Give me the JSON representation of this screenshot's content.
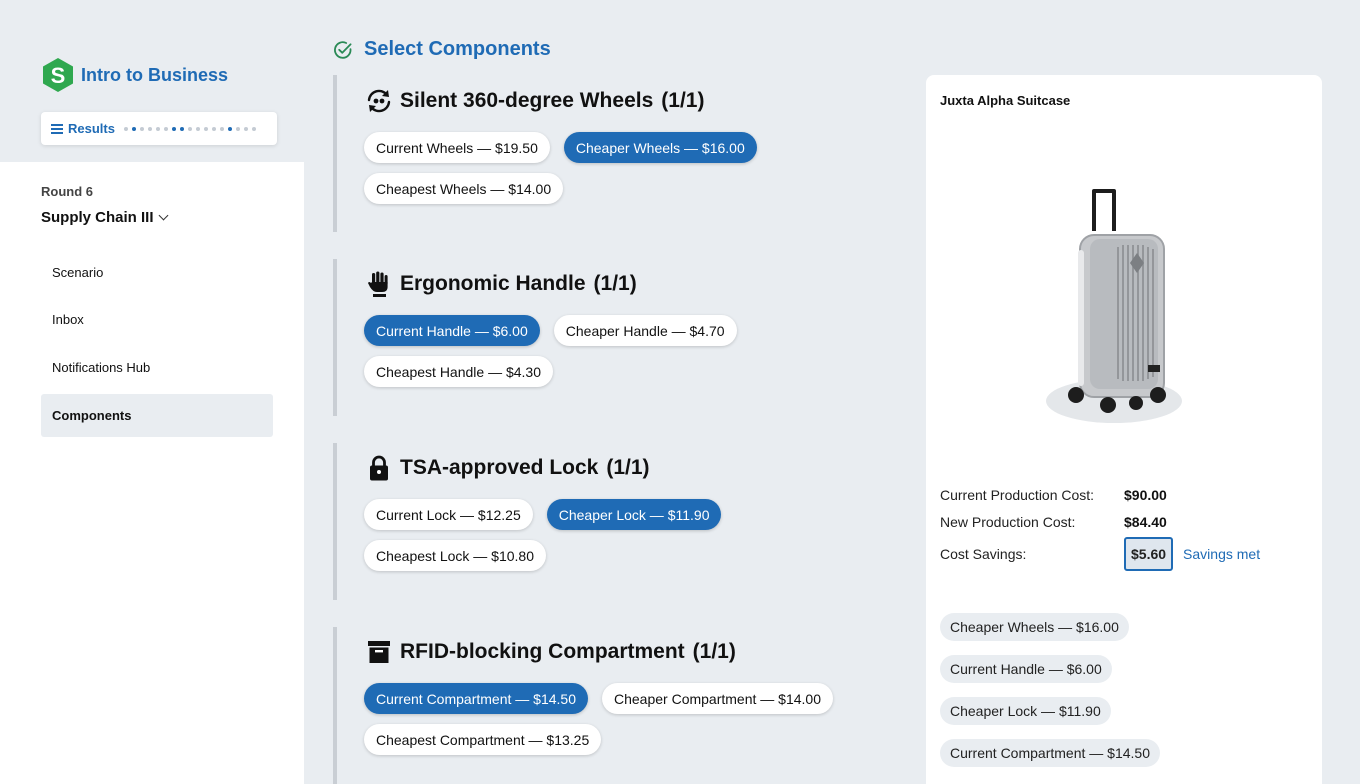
{
  "brand": {
    "name": "Intro to Business",
    "logo_letter": "S"
  },
  "results": {
    "label": "Results"
  },
  "sidebar": {
    "round": "Round 6",
    "chapter": "Supply Chain III",
    "items": [
      {
        "label": "Scenario"
      },
      {
        "label": "Inbox"
      },
      {
        "label": "Notifications Hub"
      },
      {
        "label": "Components"
      }
    ]
  },
  "main": {
    "title": "Select Components",
    "sections": [
      {
        "title": "Silent 360-degree Wheels",
        "count": "(1/1)",
        "icon": "wheels-rotate-icon",
        "options": [
          {
            "label": "Current Wheels — $19.50",
            "selected": false
          },
          {
            "label": "Cheaper Wheels — $16.00",
            "selected": true
          },
          {
            "label": "Cheapest Wheels — $14.00",
            "selected": false
          }
        ]
      },
      {
        "title": "Ergonomic Handle",
        "count": "(1/1)",
        "icon": "hand-icon",
        "options": [
          {
            "label": "Current Handle — $6.00",
            "selected": true
          },
          {
            "label": "Cheaper Handle — $4.70",
            "selected": false
          },
          {
            "label": "Cheapest Handle — $4.30",
            "selected": false
          }
        ]
      },
      {
        "title": "TSA-approved Lock",
        "count": "(1/1)",
        "icon": "lock-icon",
        "options": [
          {
            "label": "Current Lock — $12.25",
            "selected": false
          },
          {
            "label": "Cheaper Lock — $11.90",
            "selected": true
          },
          {
            "label": "Cheapest Lock — $10.80",
            "selected": false
          }
        ]
      },
      {
        "title": "RFID-blocking Compartment",
        "count": "(1/1)",
        "icon": "archive-box-icon",
        "options": [
          {
            "label": "Current Compartment — $14.50",
            "selected": true
          },
          {
            "label": "Cheaper Compartment — $14.00",
            "selected": false
          },
          {
            "label": "Cheapest Compartment — $13.25",
            "selected": false
          }
        ]
      }
    ]
  },
  "card": {
    "title": "Juxta Alpha Suitcase",
    "current_cost_label": "Current Production Cost:",
    "current_cost": "$90.00",
    "new_cost_label": "New Production Cost:",
    "new_cost": "$84.40",
    "savings_label": "Cost Savings:",
    "savings": "$5.60",
    "savings_status": "Savings met",
    "selected": [
      "Cheaper Wheels — $16.00",
      "Current Handle — $6.00",
      "Cheaper Lock — $11.90",
      "Current Compartment — $14.50"
    ]
  },
  "colors": {
    "accent": "#1f6bb5",
    "brand_green": "#2fa84f",
    "background": "#e9edf1"
  }
}
